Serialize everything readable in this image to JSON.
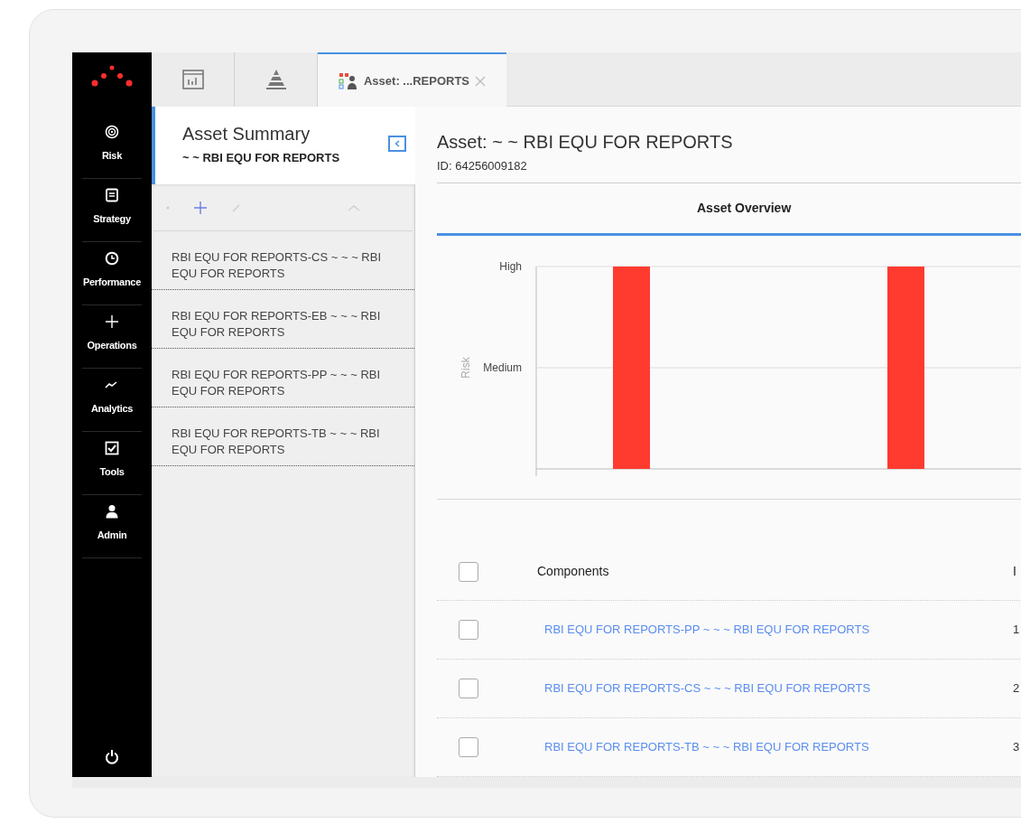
{
  "nav": {
    "items": [
      {
        "kind": "target",
        "label": "Risk"
      },
      {
        "kind": "list",
        "label": "Strategy"
      },
      {
        "kind": "clock",
        "label": "Performance"
      },
      {
        "kind": "plus",
        "label": "Operations"
      },
      {
        "kind": "trend",
        "label": "Analytics"
      },
      {
        "kind": "check",
        "label": "Tools"
      },
      {
        "kind": "user",
        "label": "Admin"
      }
    ]
  },
  "tabs": [
    {
      "kind": "chart",
      "selected": false
    },
    {
      "kind": "pyramid",
      "selected": false
    },
    {
      "kind": "asset",
      "label": "Asset: ...REPORTS",
      "selected": true,
      "closable": true
    }
  ],
  "summary": {
    "title": "Asset Summary",
    "subtitle": "~ ~ RBI EQU FOR REPORTS",
    "items": [
      {
        "label": "RBI EQU FOR REPORTS-CS ~ ~ ~ RBI EQU FOR REPORTS"
      },
      {
        "label": "RBI EQU FOR REPORTS-EB ~ ~ ~ RBI EQU FOR REPORTS"
      },
      {
        "label": "RBI EQU FOR REPORTS-PP ~ ~ ~ RBI EQU FOR REPORTS"
      },
      {
        "label": "RBI EQU FOR REPORTS-TB ~ ~ ~ RBI EQU FOR REPORTS"
      }
    ]
  },
  "asset": {
    "title": "Asset: ~ ~ RBI EQU FOR REPORTS",
    "id": "ID: 64256009182",
    "section": "Asset Overview",
    "risk_chart": {
      "axis_title": "Risk",
      "axis_labels": [
        "High",
        "Medium"
      ]
    }
  },
  "table": {
    "columns": [
      "Components",
      "I"
    ],
    "header_checked": false,
    "rows": [
      {
        "checked": false,
        "cells": [
          "RBI EQU FOR REPORTS-PP ~ ~ ~ RBI EQU FOR REPORTS",
          "1"
        ]
      },
      {
        "checked": false,
        "cells": [
          "RBI EQU FOR REPORTS-CS ~ ~ ~ RBI EQU FOR REPORTS",
          "2"
        ]
      },
      {
        "checked": false,
        "cells": [
          "RBI EQU FOR REPORTS-TB ~ ~ ~ RBI EQU FOR REPORTS",
          "3"
        ]
      }
    ]
  }
}
